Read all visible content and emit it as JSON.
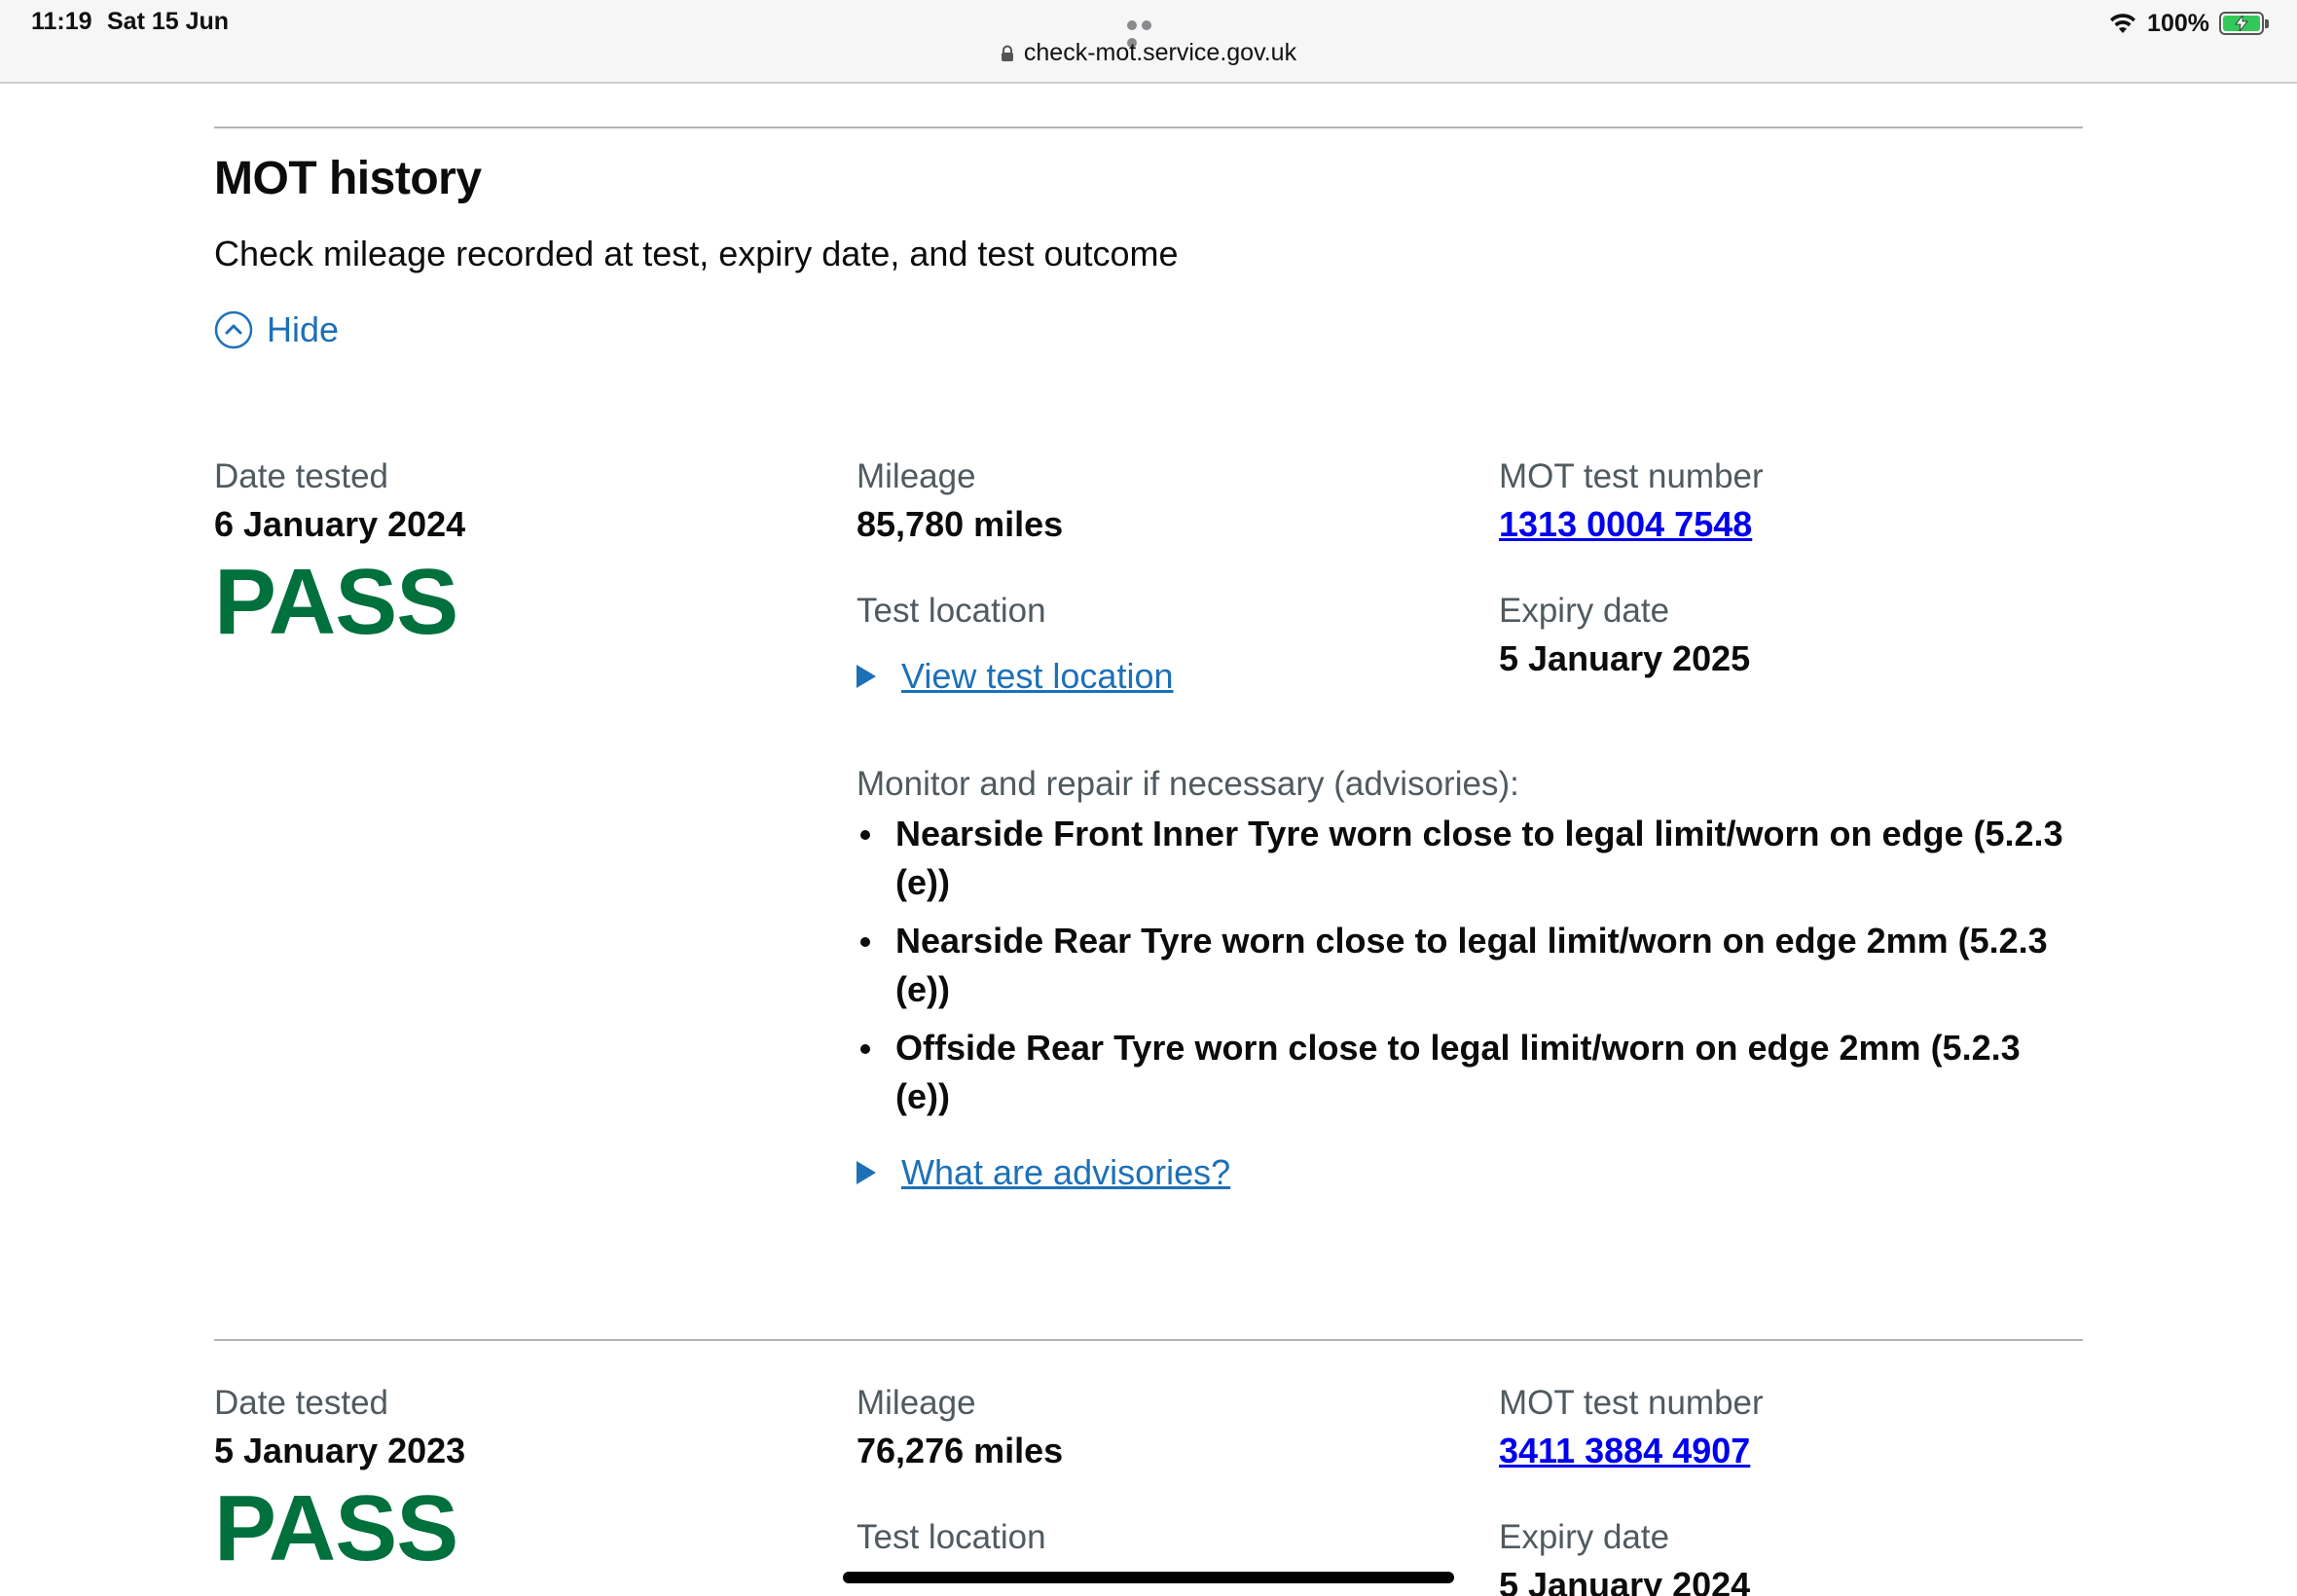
{
  "status_bar": {
    "time": "11:19",
    "date": "Sat 15 Jun",
    "battery": "100%",
    "url": "check-mot.service.gov.uk"
  },
  "section": {
    "title": "MOT history",
    "lead": "Check mileage recorded at test, expiry date, and test outcome",
    "toggle_label": "Hide"
  },
  "labels": {
    "date_tested": "Date tested",
    "mileage": "Mileage",
    "test_number": "MOT test number",
    "test_location": "Test location",
    "expiry_date": "Expiry date",
    "view_location": "View test location",
    "advisories_heading": "Monitor and repair if necessary (advisories):",
    "what_are_advisories": "What are advisories?"
  },
  "tests": [
    {
      "date": "6 January 2024",
      "result": "PASS",
      "mileage": "85,780 miles",
      "test_number": "1313 0004 7548",
      "expiry": "5 January 2025",
      "advisories": [
        "Nearside Front Inner Tyre worn close to legal limit/worn on edge (5.2.3 (e))",
        "Nearside Rear Tyre worn close to legal limit/worn on edge 2mm (5.2.3 (e))",
        "Offside Rear Tyre worn close to legal limit/worn on edge 2mm (5.2.3 (e))"
      ]
    },
    {
      "date": "5 January 2023",
      "result": "PASS",
      "mileage": "76,276 miles",
      "test_number": "3411 3884 4907",
      "expiry": "5 January 2024"
    }
  ],
  "colors": {
    "pass_green": "#00703c",
    "link_blue": "#1d70b8",
    "test_number_link": "#0000ee",
    "secondary_text": "#505a5f"
  }
}
